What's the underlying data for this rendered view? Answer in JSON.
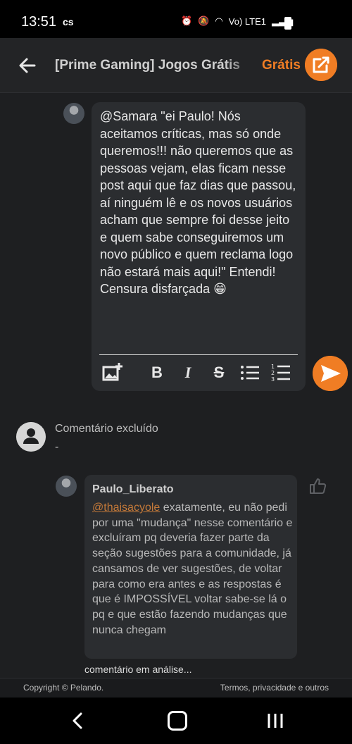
{
  "status_bar": {
    "time": "13:51",
    "carrier_mark": "cs",
    "network": "Vo) LTE1"
  },
  "app_bar": {
    "title": "[Prime Gaming] Jogos Grátis",
    "price": "Grátis",
    "back_icon": "arrow-left-icon",
    "open_icon": "external-link-icon",
    "accent_color": "#f07d24"
  },
  "composer": {
    "text": "@Samara \"ei Paulo! Nós aceitamos críticas, mas só onde queremos!!! não queremos que as pessoas vejam, elas ficam nesse post aqui que faz dias que passou, aí ninguém lê e os novos usuários acham que sempre foi desse jeito e quem sabe conseguiremos um novo público e quem reclama logo não estará mais aqui!\" Entendi! Censura disfarçada 😁",
    "tools": [
      "image-add-icon",
      "bold-icon",
      "italic-icon",
      "strikethrough-icon",
      "bullet-list-icon",
      "numbered-list-icon"
    ],
    "send_icon": "send-icon"
  },
  "deleted_comment": {
    "title": "Comentário excluído",
    "body": "-"
  },
  "reply": {
    "author": "Paulo_Liberato",
    "mention": "@thaisacyole",
    "text": " exatamente, eu não pedi por uma \"mudança\" nesse comentário e excluíram pq deveria fazer parte da seção sugestões para a comunidade, já cansamos de ver sugestões, de voltar para como era antes e as respostas é que é IMPOSSÍVEL voltar sabe-se lá o pq e que estão fazendo mudanças que nunca chegam",
    "status": "comentário em análise...",
    "like_icon": "thumbs-up-icon"
  },
  "footer": {
    "copyright": "Copyright © Pelando.",
    "links": "Termos, privacidade e outros"
  },
  "navbar": {
    "back": "nav-back-icon",
    "home": "nav-home-icon",
    "recent": "nav-recent-icon"
  }
}
